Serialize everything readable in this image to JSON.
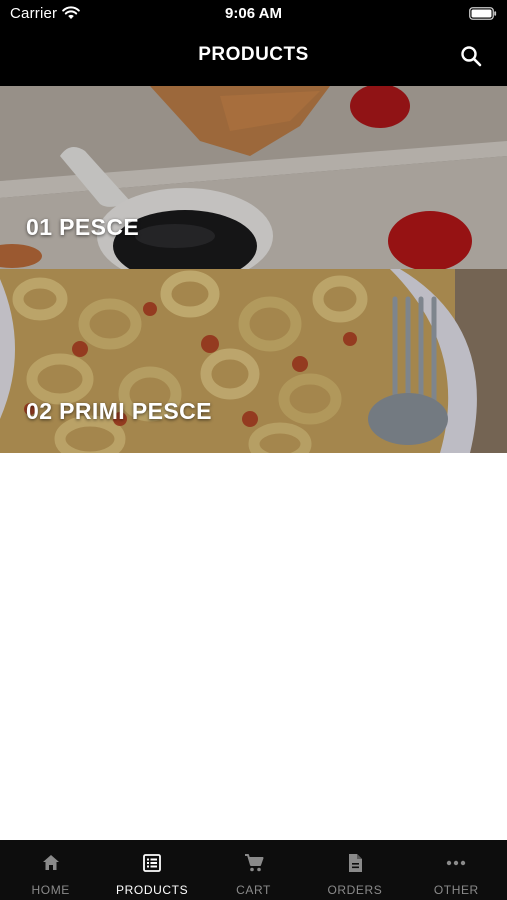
{
  "status_bar": {
    "carrier": "Carrier",
    "time": "9:06 AM"
  },
  "header": {
    "title": "PRODUCTS",
    "search_icon": "search-icon"
  },
  "categories": [
    {
      "label": "01 PESCE"
    },
    {
      "label": "02 PRIMI PESCE"
    }
  ],
  "tab_bar": {
    "active": "PRODUCTS",
    "items": [
      {
        "label": "HOME",
        "icon": "home-icon"
      },
      {
        "label": "PRODUCTS",
        "icon": "list-icon"
      },
      {
        "label": "CART",
        "icon": "cart-icon"
      },
      {
        "label": "ORDERS",
        "icon": "document-icon"
      },
      {
        "label": "OTHER",
        "icon": "more-icon"
      }
    ]
  },
  "colors": {
    "bar_background": "#000000",
    "tab_inactive": "#8a8a8a",
    "tab_active": "#ffffff"
  }
}
